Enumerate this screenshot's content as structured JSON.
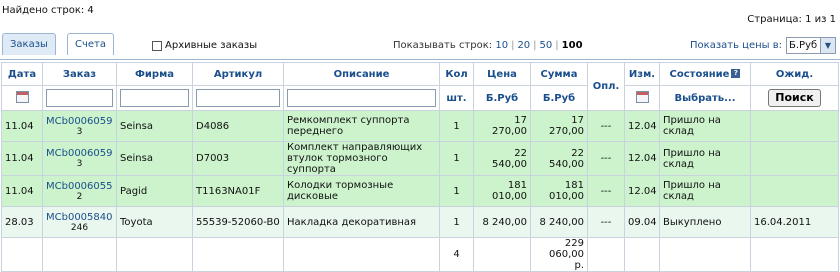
{
  "summary": {
    "found": "Найдено строк: 4",
    "page": "Страница: 1 из 1"
  },
  "tabs": [
    {
      "label": "Заказы"
    },
    {
      "label": "Счета"
    }
  ],
  "archive": {
    "label": "Архивные заказы"
  },
  "rows_per_page": {
    "label": "Показывать строк:",
    "options": [
      "10",
      "20",
      "50",
      "100"
    ],
    "current": "100"
  },
  "price": {
    "label": "Показать цены в:",
    "value": "Б.Руб"
  },
  "headers": {
    "date": "Дата",
    "order": "Заказ",
    "firm": "Фирма",
    "article": "Артикул",
    "desc": "Описание",
    "qty": "Кол",
    "price": "Цена",
    "sum": "Сумма",
    "paid": "Опл.",
    "changed": "Изм.",
    "status": "Состояние",
    "expected": "Ожид."
  },
  "subheaders": {
    "qty_unit": "шт.",
    "price_unit": "Б.Руб",
    "sum_unit": "Б.Руб",
    "status_select": "Выбрать...",
    "search_button": "Поиск"
  },
  "rows": [
    {
      "date": "11.04",
      "order": "MCb0006059",
      "order_sub": "3",
      "firm": "Seinsa",
      "article": "D4086",
      "desc": "Ремкомплект суппорта переднего",
      "qty": "1",
      "price": "17 270,00",
      "sum": "17 270,00",
      "paid": "---",
      "changed": "12.04",
      "status": "Пришло на склад",
      "expected": ""
    },
    {
      "date": "11.04",
      "order": "MCb0006059",
      "order_sub": "3",
      "firm": "Seinsa",
      "article": "D7003",
      "desc": "Комплект направляющих втулок тормозного суппорта",
      "qty": "1",
      "price": "22 540,00",
      "sum": "22 540,00",
      "paid": "---",
      "changed": "12.04",
      "status": "Пришло на склад",
      "expected": ""
    },
    {
      "date": "11.04",
      "order": "MCb0006055",
      "order_sub": "2",
      "firm": "Pagid",
      "article": "T1163NA01F",
      "desc": "Колодки тормозные дисковые",
      "qty": "1",
      "price": "181 010,00",
      "sum": "181 010,00",
      "paid": "---",
      "changed": "12.04",
      "status": "Пришло на склад",
      "expected": ""
    },
    {
      "date": "28.03",
      "order": "MCb0005840",
      "order_sub": "246",
      "firm": "Toyota",
      "article": "55539-52060-B0",
      "desc": "Накладка декоративная",
      "qty": "1",
      "price": "8 240,00",
      "sum": "8 240,00",
      "paid": "---",
      "changed": "09.04",
      "status": "Выкуплено",
      "expected": "16.04.2011"
    }
  ],
  "totals": {
    "qty": "4",
    "sum": "229 060,00",
    "sum_unit": "р."
  },
  "colors": {
    "accent": "#1a4f8c",
    "row_green": "#ccf3cc",
    "row_light": "#e9f7ee",
    "border": "#c8d3df"
  }
}
